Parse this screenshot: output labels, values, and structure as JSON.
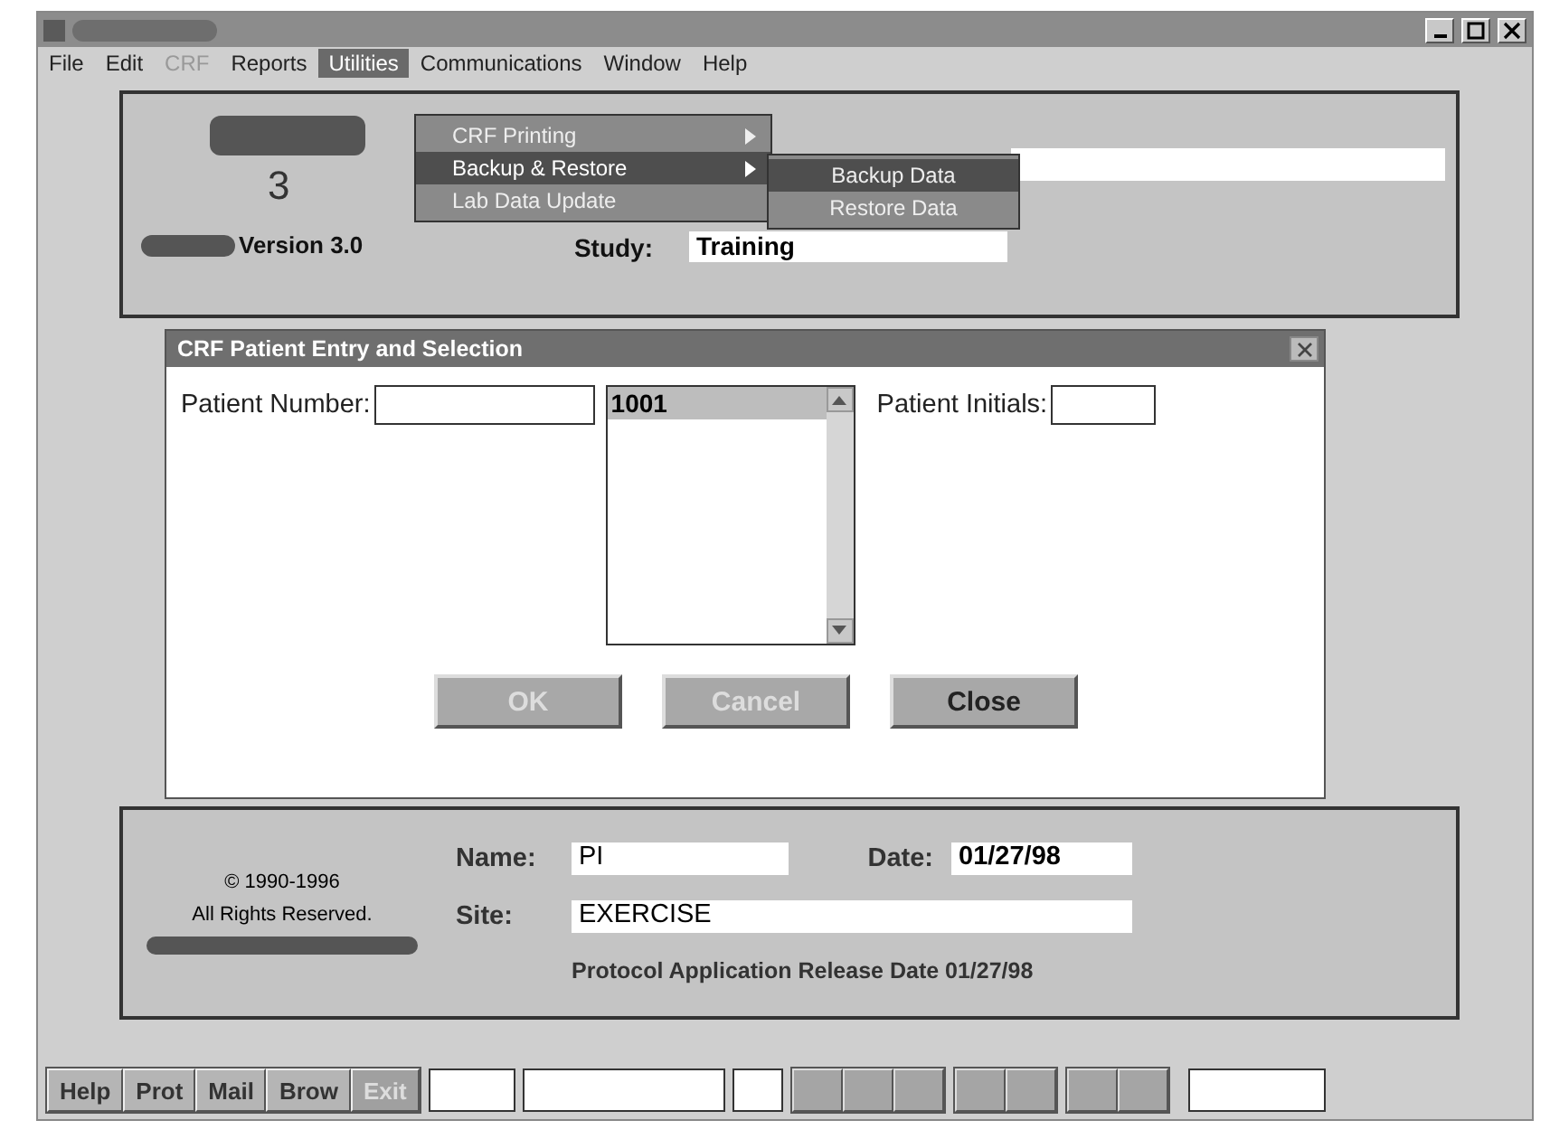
{
  "menu": [
    {
      "label": "File",
      "disabled": false,
      "selected": false
    },
    {
      "label": "Edit",
      "disabled": false,
      "selected": false
    },
    {
      "label": "CRF",
      "disabled": true,
      "selected": false
    },
    {
      "label": "Reports",
      "disabled": false,
      "selected": false
    },
    {
      "label": "Utilities",
      "disabled": false,
      "selected": true
    },
    {
      "label": "Communications",
      "disabled": false,
      "selected": false
    },
    {
      "label": "Window",
      "disabled": false,
      "selected": false
    },
    {
      "label": "Help",
      "disabled": false,
      "selected": false
    }
  ],
  "dropdown": [
    {
      "label": "CRF Printing",
      "submenu": true,
      "selected": false
    },
    {
      "label": "Backup & Restore",
      "submenu": true,
      "selected": true
    },
    {
      "label": "Lab Data Update",
      "submenu": false,
      "selected": false
    }
  ],
  "submenu": [
    {
      "label": "Backup Data",
      "selected": true
    },
    {
      "label": "Restore Data",
      "selected": false
    }
  ],
  "header": {
    "logo_digit": "3",
    "version": "Version 3.0",
    "study_label": "Study:",
    "study_value": "Training"
  },
  "dialog": {
    "title": "CRF Patient Entry and Selection",
    "patient_number_label": "Patient Number:",
    "patients": [
      {
        "label": "1001",
        "selected": true
      }
    ],
    "initials_label": "Patient Initials:",
    "buttons": [
      {
        "label": "OK",
        "disabled": true
      },
      {
        "label": "Cancel",
        "disabled": true
      },
      {
        "label": "Close",
        "disabled": false
      }
    ]
  },
  "footer": {
    "copyright": "© 1990-1996",
    "rights": "All Rights Reserved.",
    "name_label": "Name:",
    "name_value": "PI",
    "date_label": "Date:",
    "date_value": "01/27/98",
    "site_label": "Site:",
    "site_value": "EXERCISE",
    "release": "Protocol Application Release Date 01/27/98"
  },
  "toolbar": [
    {
      "label": "Help",
      "disabled": false
    },
    {
      "label": "Prot",
      "disabled": false
    },
    {
      "label": "Mail",
      "disabled": false
    },
    {
      "label": "Brow",
      "disabled": false
    },
    {
      "label": "Exit",
      "disabled": true
    }
  ]
}
